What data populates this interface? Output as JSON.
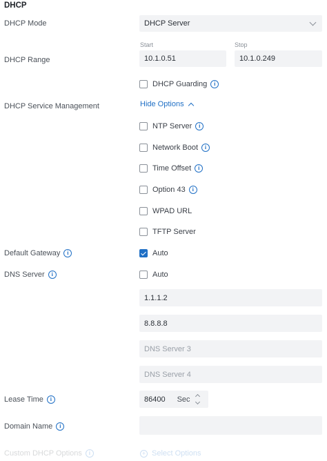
{
  "section_title": "DHCP",
  "dhcp_mode": {
    "label": "DHCP Mode",
    "value": "DHCP Server"
  },
  "dhcp_range": {
    "label": "DHCP Range",
    "start_label": "Start",
    "start_value": "10.1.0.51",
    "stop_label": "Stop",
    "stop_value": "10.1.0.249"
  },
  "dhcp_guarding": {
    "label": "DHCP Guarding",
    "checked": false
  },
  "service_mgmt": {
    "label": "DHCP Service Management",
    "toggle_label": "Hide Options",
    "options": [
      {
        "label": "NTP Server",
        "checked": false,
        "info": true
      },
      {
        "label": "Network Boot",
        "checked": false,
        "info": true
      },
      {
        "label": "Time Offset",
        "checked": false,
        "info": true
      },
      {
        "label": "Option 43",
        "checked": false,
        "info": true
      },
      {
        "label": "WPAD URL",
        "checked": false,
        "info": false
      },
      {
        "label": "TFTP Server",
        "checked": false,
        "info": false
      }
    ]
  },
  "default_gateway": {
    "label": "Default Gateway",
    "checkbox_label": "Auto",
    "checked": true
  },
  "dns_server": {
    "label": "DNS Server",
    "checkbox_label": "Auto",
    "checked": false,
    "servers": [
      "1.1.1.2",
      "8.8.8.8"
    ],
    "placeholders": [
      "DNS Server 3",
      "DNS Server 4"
    ]
  },
  "lease_time": {
    "label": "Lease Time",
    "value": "86400",
    "unit": "Sec"
  },
  "domain_name": {
    "label": "Domain Name",
    "value": ""
  },
  "custom_options": {
    "label": "Custom DHCP Options",
    "button_label": "Select Options"
  },
  "colors": {
    "accent": "#1f6fc5",
    "field_bg": "#f2f3f5",
    "text": "#3a3f47"
  }
}
